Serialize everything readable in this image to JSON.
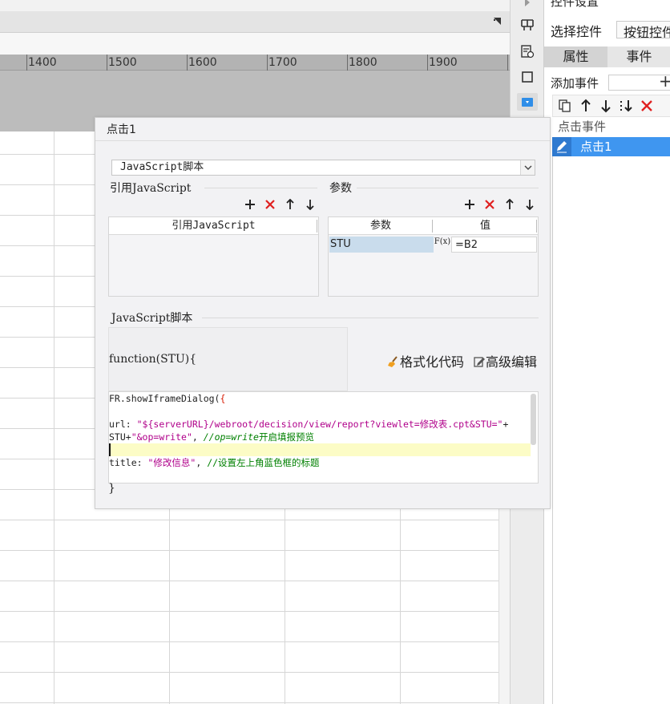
{
  "designer": {
    "ruler_labels": [
      "1400",
      "1500",
      "1600",
      "1700",
      "1800",
      "1900"
    ]
  },
  "properties_panel": {
    "title": "控件设置",
    "select_widget_label": "选择控件",
    "widget_name": "按钮控件",
    "tabs": [
      "属性",
      "事件"
    ],
    "active_tab": "事件",
    "add_event_label": "添加事件",
    "event_group": "点击事件",
    "event_item": "点击1"
  },
  "dialog": {
    "title": "点击1",
    "script_type": "JavaScript脚本",
    "ref_js_section": "引用JavaScript",
    "ref_js_column": "引用JavaScript",
    "params_section": "参数",
    "params_columns": [
      "参数",
      "值"
    ],
    "params_rows": [
      {
        "name": "STU",
        "fx_label": "F(x)",
        "value": "=B2"
      }
    ],
    "js_section": "JavaScript脚本",
    "function_signature": "function(STU){",
    "format_code_label": "格式化代码",
    "advanced_edit_label": "高级编辑",
    "code_lines": [
      {
        "parts": [
          [
            "plain",
            "FR.showIframeDialog("
          ],
          [
            "red",
            "{"
          ]
        ]
      },
      {
        "parts": []
      },
      {
        "parts": [
          [
            "plain",
            "url: "
          ],
          [
            "str",
            "\"${serverURL}/webroot/decision/view/report?viewlet=修改表.cpt&STU=\""
          ],
          [
            "plain",
            "+"
          ]
        ]
      },
      {
        "parts": [
          [
            "plain",
            "STU+"
          ],
          [
            "str",
            "\"&op=write\""
          ],
          [
            "plain",
            ", "
          ],
          [
            "cmt",
            "//op=write"
          ],
          [
            "cmt2",
            "开启填报预览"
          ]
        ]
      },
      {
        "parts": []
      },
      {
        "parts": [
          [
            "plain",
            "title: "
          ],
          [
            "str",
            "\"修改信息\""
          ],
          [
            "plain",
            ", "
          ],
          [
            "cmt2",
            "//设置左上角蓝色框的标题"
          ]
        ]
      }
    ],
    "closing_brace": "}"
  }
}
